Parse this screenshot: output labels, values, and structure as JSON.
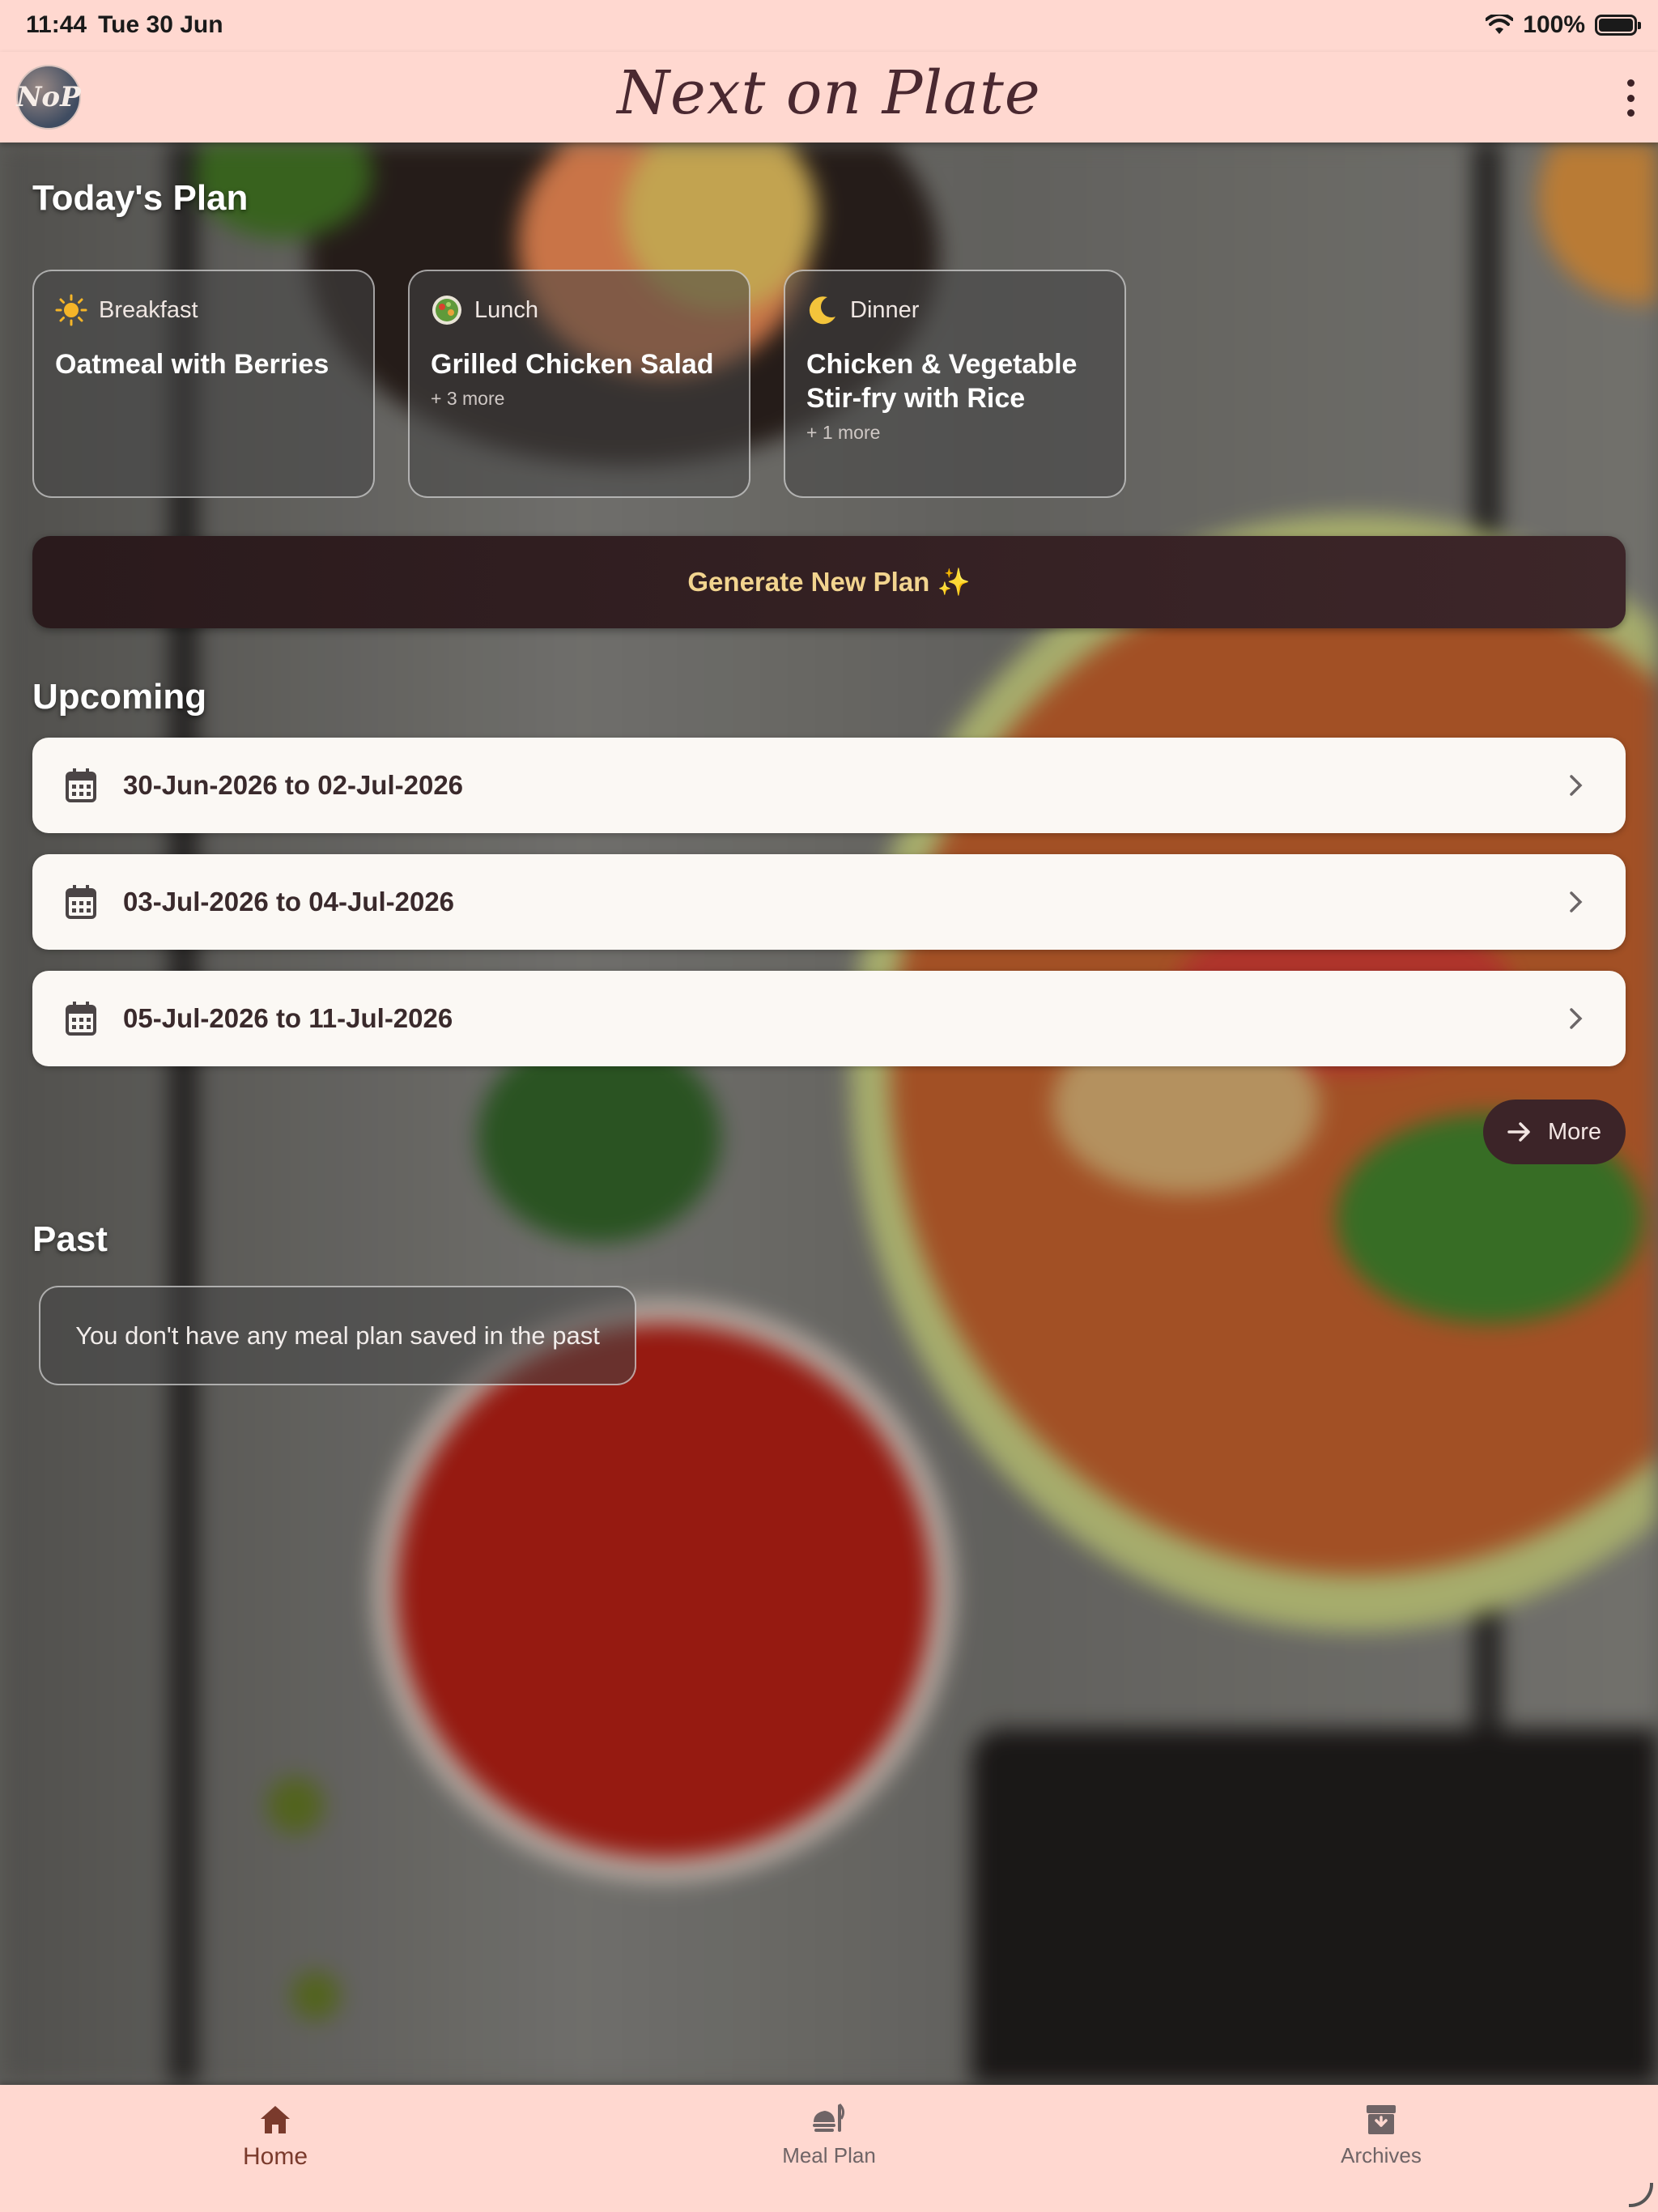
{
  "status_bar": {
    "time": "11:44",
    "date": "Tue 30 Jun",
    "battery": "100%"
  },
  "app_bar": {
    "avatar_text": "NoP",
    "title": "Next on Plate"
  },
  "today": {
    "title": "Today's Plan",
    "meals": [
      {
        "label": "Breakfast",
        "icon": "sun-icon",
        "name": "Oatmeal with Berries",
        "more": ""
      },
      {
        "label": "Lunch",
        "icon": "salad-icon",
        "name": "Grilled Chicken Salad",
        "more": "+ 3 more"
      },
      {
        "label": "Dinner",
        "icon": "moon-icon",
        "name": "Chicken & Vegetable Stir-fry with Rice",
        "more": "+ 1 more"
      }
    ]
  },
  "generate": {
    "label": "Generate New Plan ✨"
  },
  "upcoming": {
    "title": "Upcoming",
    "plans": [
      {
        "range": "30-Jun-2026 to 02-Jul-2026"
      },
      {
        "range": "03-Jul-2026 to 04-Jul-2026"
      },
      {
        "range": "05-Jul-2026 to 11-Jul-2026"
      }
    ],
    "more_label": "More"
  },
  "past": {
    "title": "Past",
    "empty_message": "You don't have any meal plan saved in the past"
  },
  "bottom_nav": {
    "items": [
      {
        "label": "Home",
        "icon": "home-icon",
        "active": true
      },
      {
        "label": "Meal Plan",
        "icon": "meal-plan-icon",
        "active": false
      },
      {
        "label": "Archives",
        "icon": "archive-icon",
        "active": false
      }
    ]
  },
  "colors": {
    "bar_background": "#ffd8d0",
    "brand": "#4a2830",
    "button_dark": "#2a1a1c",
    "button_text": "#f2d48f",
    "active_nav": "#7a3a2c"
  }
}
